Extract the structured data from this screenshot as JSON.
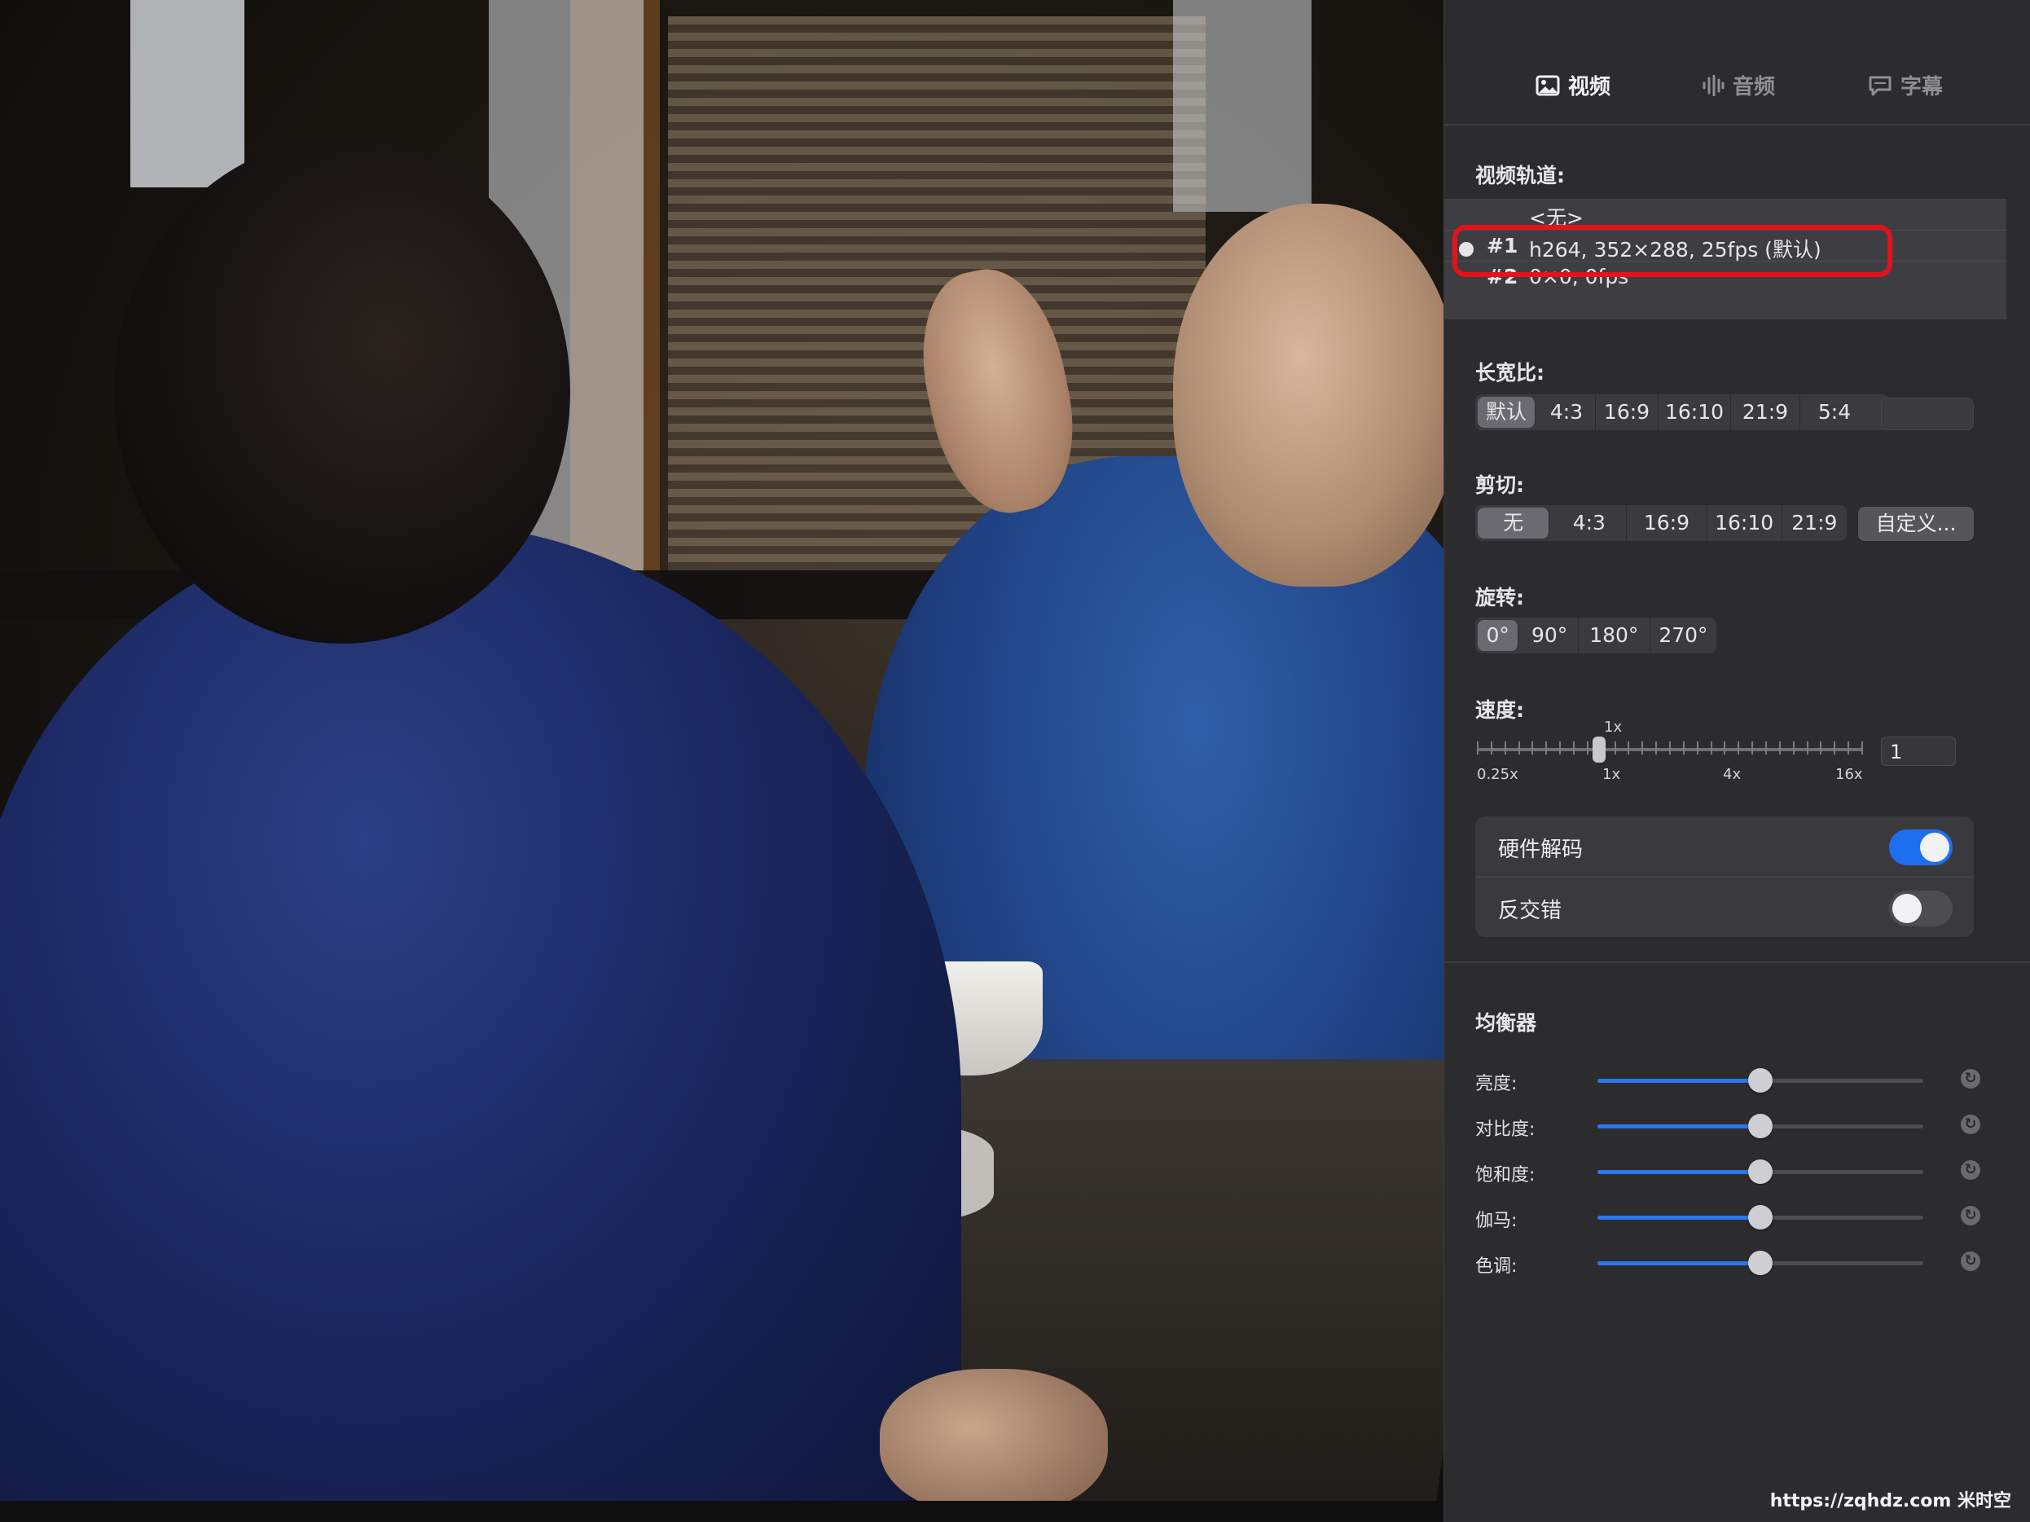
{
  "tabs": [
    {
      "label": "视频",
      "icon": "image-icon"
    },
    {
      "label": "音频",
      "icon": "waveform-icon"
    },
    {
      "label": "字幕",
      "icon": "speech-bubble-icon"
    }
  ],
  "video_track": {
    "title": "视频轨道:",
    "tracks": [
      {
        "num": "",
        "text": "<无>"
      },
      {
        "num": "#1",
        "text": "h264, 352×288, 25fps (默认)",
        "selected": true
      },
      {
        "num": "#2",
        "text": "0×0, 0fps"
      }
    ]
  },
  "aspect_ratio": {
    "title": "长宽比:",
    "options": [
      "默认",
      "4:3",
      "16:9",
      "16:10",
      "21:9",
      "5:4"
    ],
    "selected": "默认"
  },
  "crop": {
    "title": "剪切:",
    "options": [
      "无",
      "4:3",
      "16:9",
      "16:10",
      "21:9"
    ],
    "selected": "无",
    "custom_label": "自定义..."
  },
  "rotation": {
    "title": "旋转:",
    "options": [
      "0°",
      "90°",
      "180°",
      "270°"
    ],
    "selected": "0°"
  },
  "speed": {
    "title": "速度:",
    "current_label": "1x",
    "tick_labels": [
      "0.25x",
      "1x",
      "4x",
      "16x"
    ],
    "value": "1"
  },
  "toggles": {
    "hw_decode": {
      "label": "硬件解码",
      "on": true
    },
    "deinterlace": {
      "label": "反交错",
      "on": false
    }
  },
  "equalizer": {
    "title": "均衡器",
    "rows": [
      {
        "label": "亮度:",
        "level": 0.5
      },
      {
        "label": "对比度:",
        "level": 0.5
      },
      {
        "label": "饱和度:",
        "level": 0.5
      },
      {
        "label": "伽马:",
        "level": 0.5
      },
      {
        "label": "色调:",
        "level": 0.5
      }
    ]
  },
  "watermark": "https://zqhdz.com 米时空",
  "colors": {
    "accent": "#1e6ff0",
    "highlight_ring": "#e3121b",
    "panel_bg": "#2c2c2f"
  }
}
